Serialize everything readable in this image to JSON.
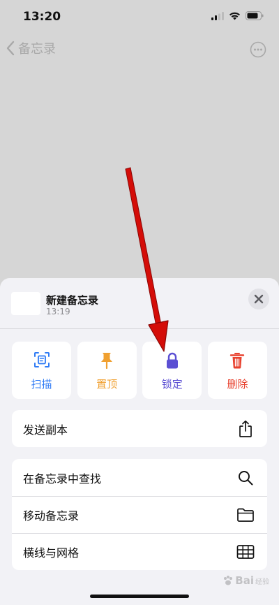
{
  "status_bar": {
    "time": "13:20"
  },
  "nav": {
    "back_label": "备忘录"
  },
  "sheet": {
    "note_title": "新建备忘录",
    "note_time": "13:19",
    "actions": [
      {
        "label": "扫描",
        "icon": "scan-icon",
        "color": "#2f7bf5"
      },
      {
        "label": "置顶",
        "icon": "pin-icon",
        "color": "#f0a030"
      },
      {
        "label": "锁定",
        "icon": "lock-icon",
        "color": "#5b4fd3"
      },
      {
        "label": "删除",
        "icon": "trash-icon",
        "color": "#e8412e"
      }
    ],
    "send_copy": {
      "label": "发送副本",
      "icon": "share-icon"
    },
    "menu": [
      {
        "label": "在备忘录中查找",
        "icon": "search-icon"
      },
      {
        "label": "移动备忘录",
        "icon": "folder-icon"
      },
      {
        "label": "横线与网格",
        "icon": "grid-icon"
      }
    ]
  },
  "colors": {
    "annotation_arrow": "#e8120c",
    "sheet_bg": "#f2f2f6"
  },
  "watermark": {
    "text": "Bai",
    "sub": "经验"
  }
}
